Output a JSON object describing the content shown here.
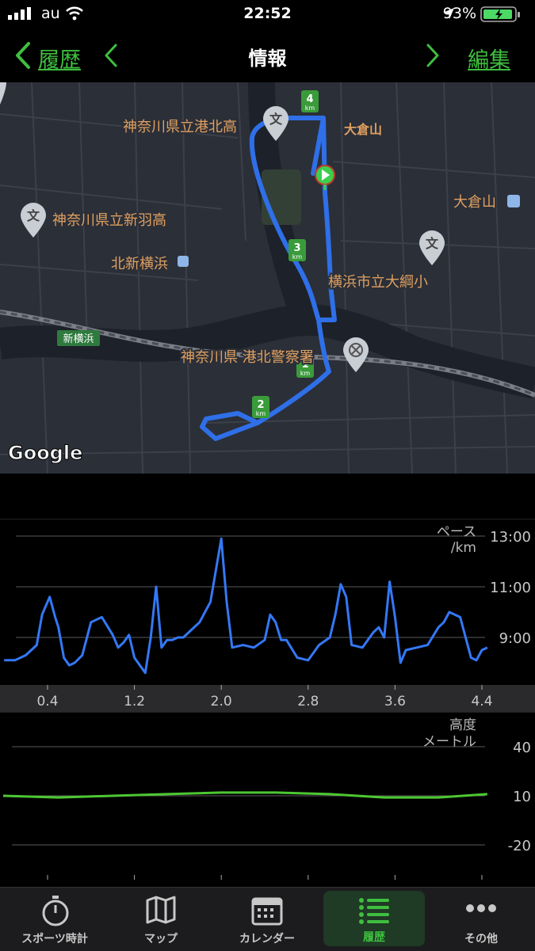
{
  "status_bar": {
    "carrier": "au",
    "time": "22:52",
    "battery_percent": "93%"
  },
  "nav": {
    "back_label": "履歴",
    "title": "情報",
    "edit_label": "編集"
  },
  "map": {
    "attribution": "Google",
    "labels": {
      "school_kohoku": "神奈川県立港北高",
      "school_nippa": "神奈川県立新羽高",
      "okurayama": "大倉山",
      "okurayama_station": "大倉山",
      "kitashinyokohama": "北新横浜",
      "school_otsuna": "横浜市立大綱小",
      "shinyokohama": "新横浜",
      "police": "神奈川県 港北警察署"
    },
    "km_markers": [
      "1",
      "2",
      "3",
      "4"
    ],
    "km_unit": "km",
    "school_glyph": "文"
  },
  "pace_chart": {
    "label_title": "ペース",
    "label_unit": "/km",
    "y_ticks": [
      "13:00",
      "11:00",
      "9:00"
    ],
    "x_ticks": [
      "0.4",
      "1.2",
      "2.0",
      "2.8",
      "3.6",
      "4.4"
    ],
    "line_color": "#3478f6"
  },
  "elevation_chart": {
    "label_title": "高度",
    "label_unit": "メートル",
    "y_ticks": [
      "40",
      "10",
      "-20"
    ],
    "line_color": "#4cc832"
  },
  "chart_data": [
    {
      "type": "line",
      "title": "ペース",
      "ylabel": "/km",
      "x_tick_labels": [
        "0.4",
        "1.2",
        "2.0",
        "2.8",
        "3.6",
        "4.4"
      ],
      "y_tick_labels": [
        "13:00",
        "11:00",
        "9:00"
      ],
      "ylim_minutes": [
        7.0,
        13.5
      ],
      "x": [
        0.0,
        0.1,
        0.2,
        0.3,
        0.35,
        0.42,
        0.47,
        0.5,
        0.55,
        0.6,
        0.65,
        0.72,
        0.8,
        0.9,
        1.0,
        1.05,
        1.1,
        1.15,
        1.2,
        1.3,
        1.35,
        1.4,
        1.45,
        1.5,
        1.55,
        1.6,
        1.65,
        1.7,
        1.8,
        1.9,
        2.0,
        2.05,
        2.1,
        2.2,
        2.3,
        2.4,
        2.45,
        2.5,
        2.55,
        2.6,
        2.7,
        2.8,
        2.9,
        3.0,
        3.05,
        3.1,
        3.15,
        3.2,
        3.3,
        3.4,
        3.45,
        3.5,
        3.55,
        3.6,
        3.65,
        3.7,
        3.8,
        3.9,
        4.0,
        4.05,
        4.1,
        4.2,
        4.3,
        4.35,
        4.4,
        4.45
      ],
      "y": [
        8.1,
        8.1,
        8.3,
        8.7,
        9.9,
        10.6,
        9.8,
        9.4,
        8.2,
        7.9,
        8.0,
        8.3,
        9.6,
        9.8,
        9.1,
        8.6,
        8.8,
        9.1,
        8.2,
        7.6,
        9.0,
        11.0,
        8.6,
        8.9,
        8.9,
        9.0,
        9.0,
        9.2,
        9.6,
        10.4,
        12.9,
        10.4,
        8.6,
        8.7,
        8.6,
        8.9,
        9.9,
        9.6,
        8.9,
        8.9,
        8.2,
        8.1,
        8.7,
        9.0,
        9.9,
        11.1,
        10.6,
        8.7,
        8.6,
        9.2,
        9.4,
        9.0,
        11.2,
        9.8,
        8.0,
        8.5,
        8.6,
        8.7,
        9.4,
        9.6,
        10.0,
        9.8,
        8.2,
        8.1,
        8.5,
        8.6
      ]
    },
    {
      "type": "line",
      "title": "高度",
      "ylabel": "メートル",
      "y_tick_labels": [
        "40",
        "10",
        "-20"
      ],
      "ylim": [
        -30,
        50
      ],
      "x": [
        0.0,
        0.5,
        1.0,
        1.5,
        2.0,
        2.5,
        3.0,
        3.5,
        4.0,
        4.45
      ],
      "y": [
        10,
        9,
        10,
        11,
        12,
        12,
        11,
        9,
        9,
        11
      ]
    }
  ]
}
